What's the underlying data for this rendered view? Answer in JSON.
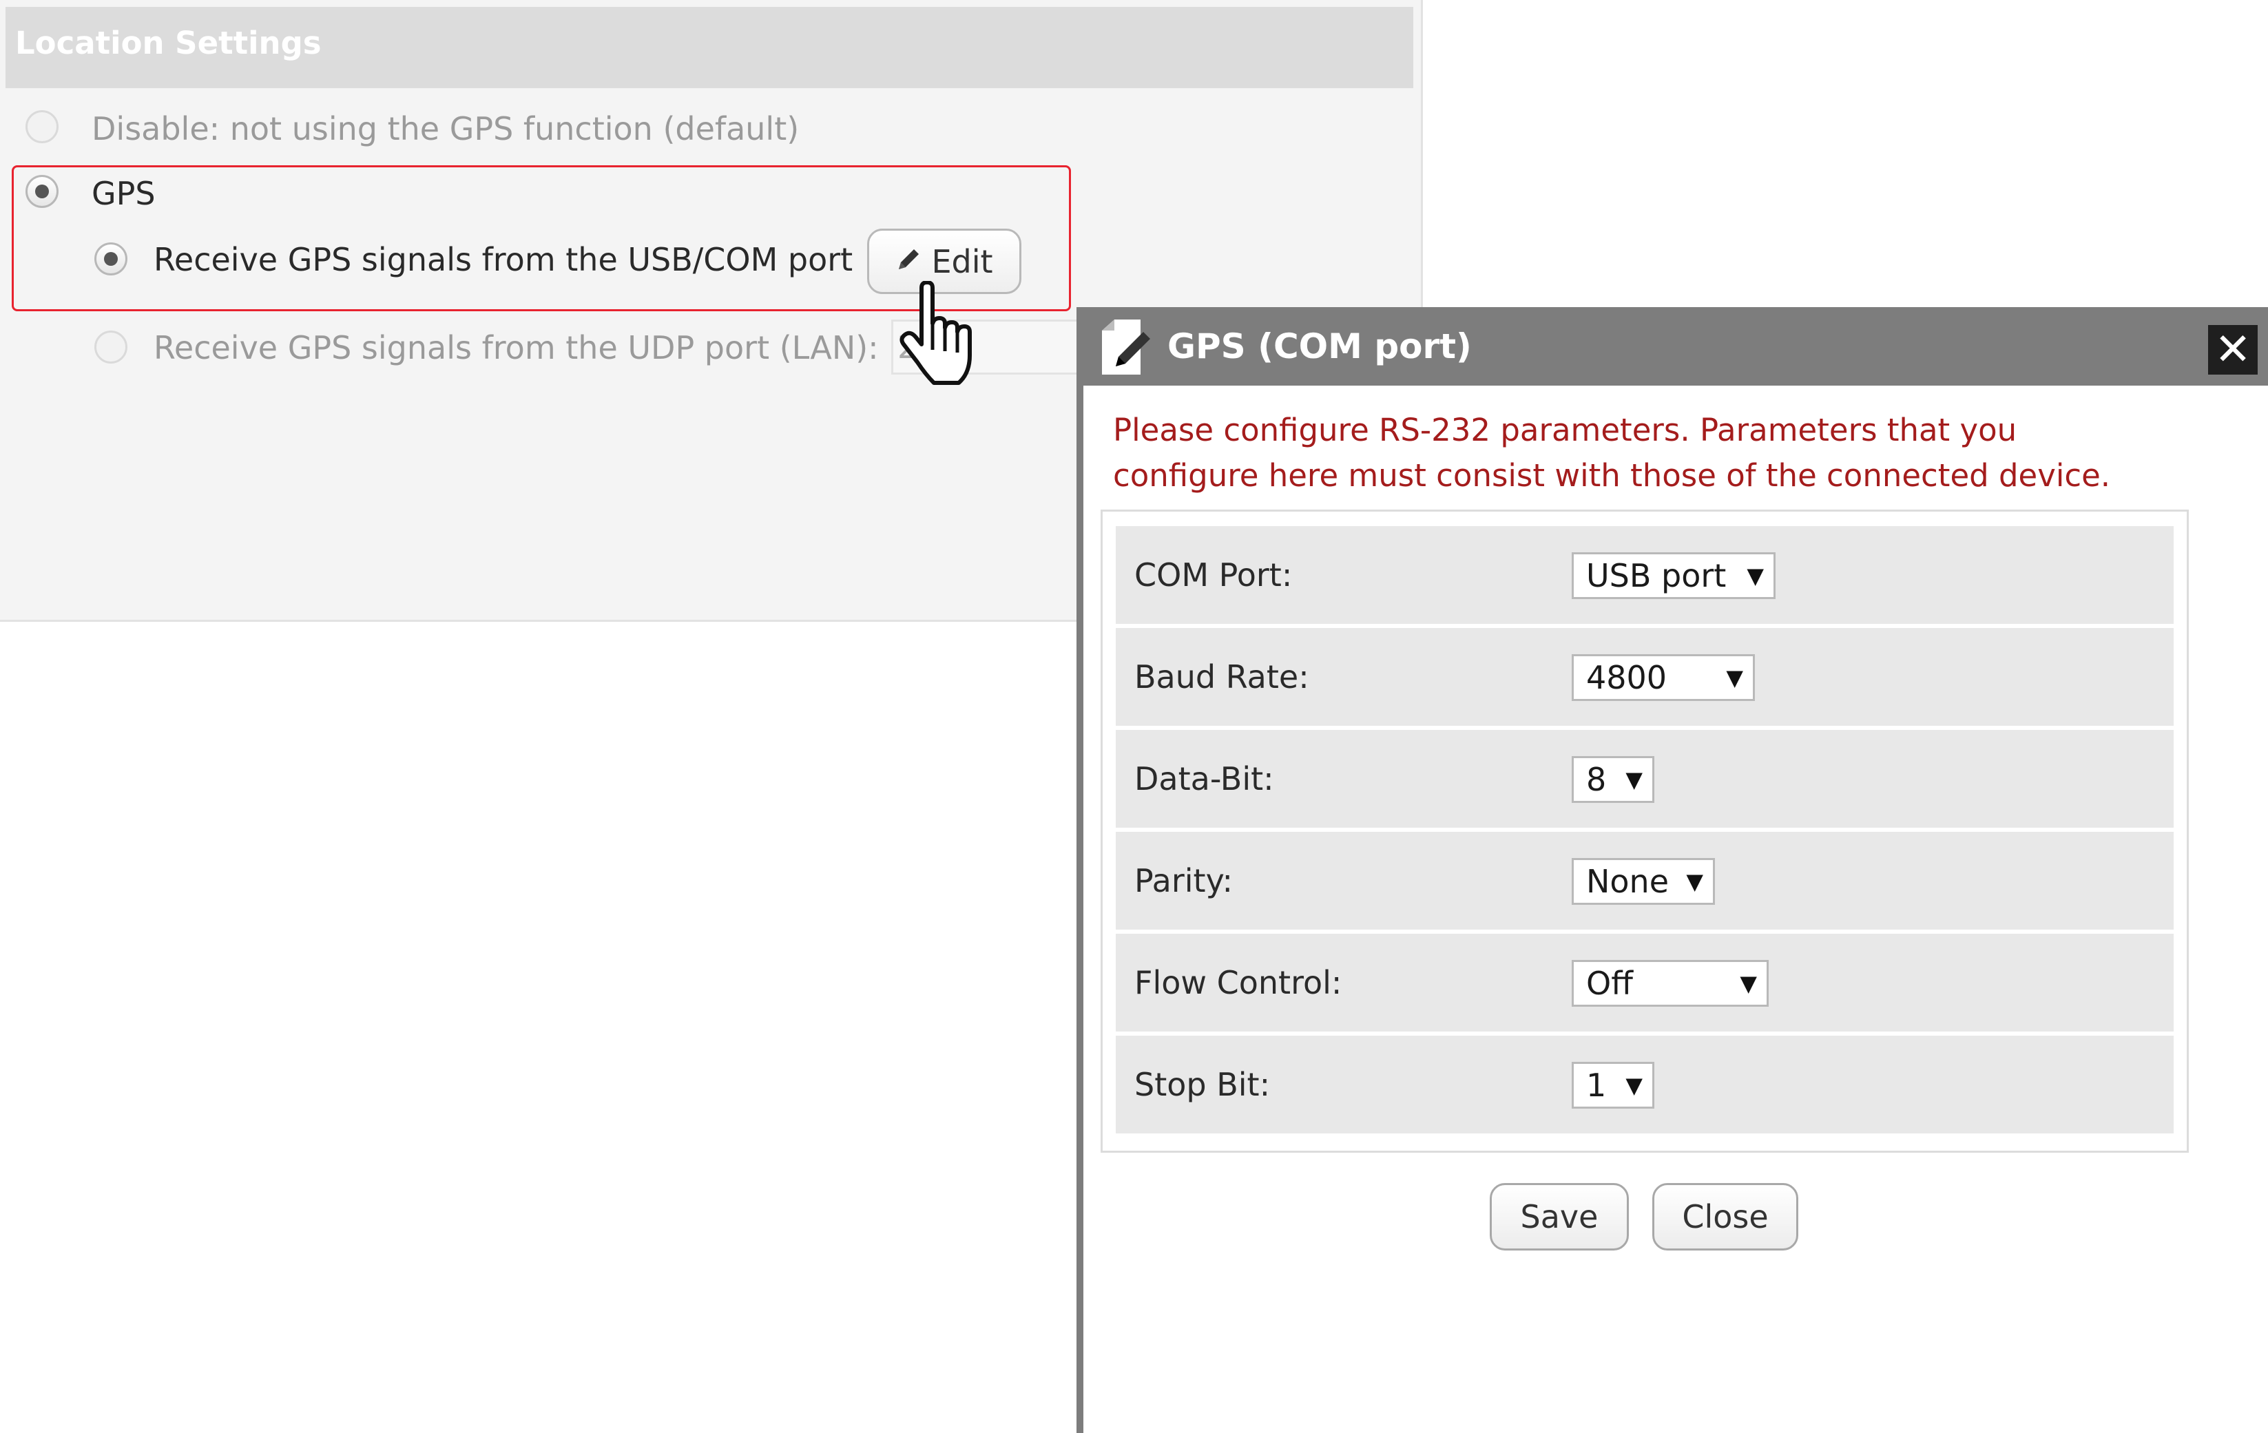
{
  "settings": {
    "title": "Location Settings",
    "options": {
      "disable": "Disable: not using the GPS function (default)",
      "gps": "GPS",
      "usb_com": "Receive GPS signals from the USB/COM port",
      "udp": "Receive GPS signals from the UDP port (LAN):"
    },
    "edit_label": "Edit",
    "udp_value": "2"
  },
  "dialog": {
    "title": "GPS (COM port)",
    "close_glyph": "✕",
    "message_line1": "Please configure RS-232 parameters. Parameters that you",
    "message_line2": "configure here must consist with those of the connected device.",
    "fields": [
      {
        "label": "COM Port:",
        "value": "USB port"
      },
      {
        "label": "Baud Rate:",
        "value": "4800"
      },
      {
        "label": "Data-Bit:",
        "value": "8"
      },
      {
        "label": "Parity:",
        "value": "None"
      },
      {
        "label": "Flow Control:",
        "value": "Off"
      },
      {
        "label": "Stop Bit:",
        "value": "1"
      }
    ],
    "save_label": "Save",
    "close_label": "Close",
    "dropdown_glyph": "▼"
  },
  "icons": {
    "pencil": "pencil-icon",
    "hand_cursor": "hand-pointer-icon",
    "dialog_edit": "edit-icon",
    "close": "close-icon"
  },
  "colors": {
    "highlight_border": "#e8232f",
    "message_text": "#a41c1c",
    "titlebar": "#7d7d7d",
    "header_bar": "#dcdcdc"
  }
}
